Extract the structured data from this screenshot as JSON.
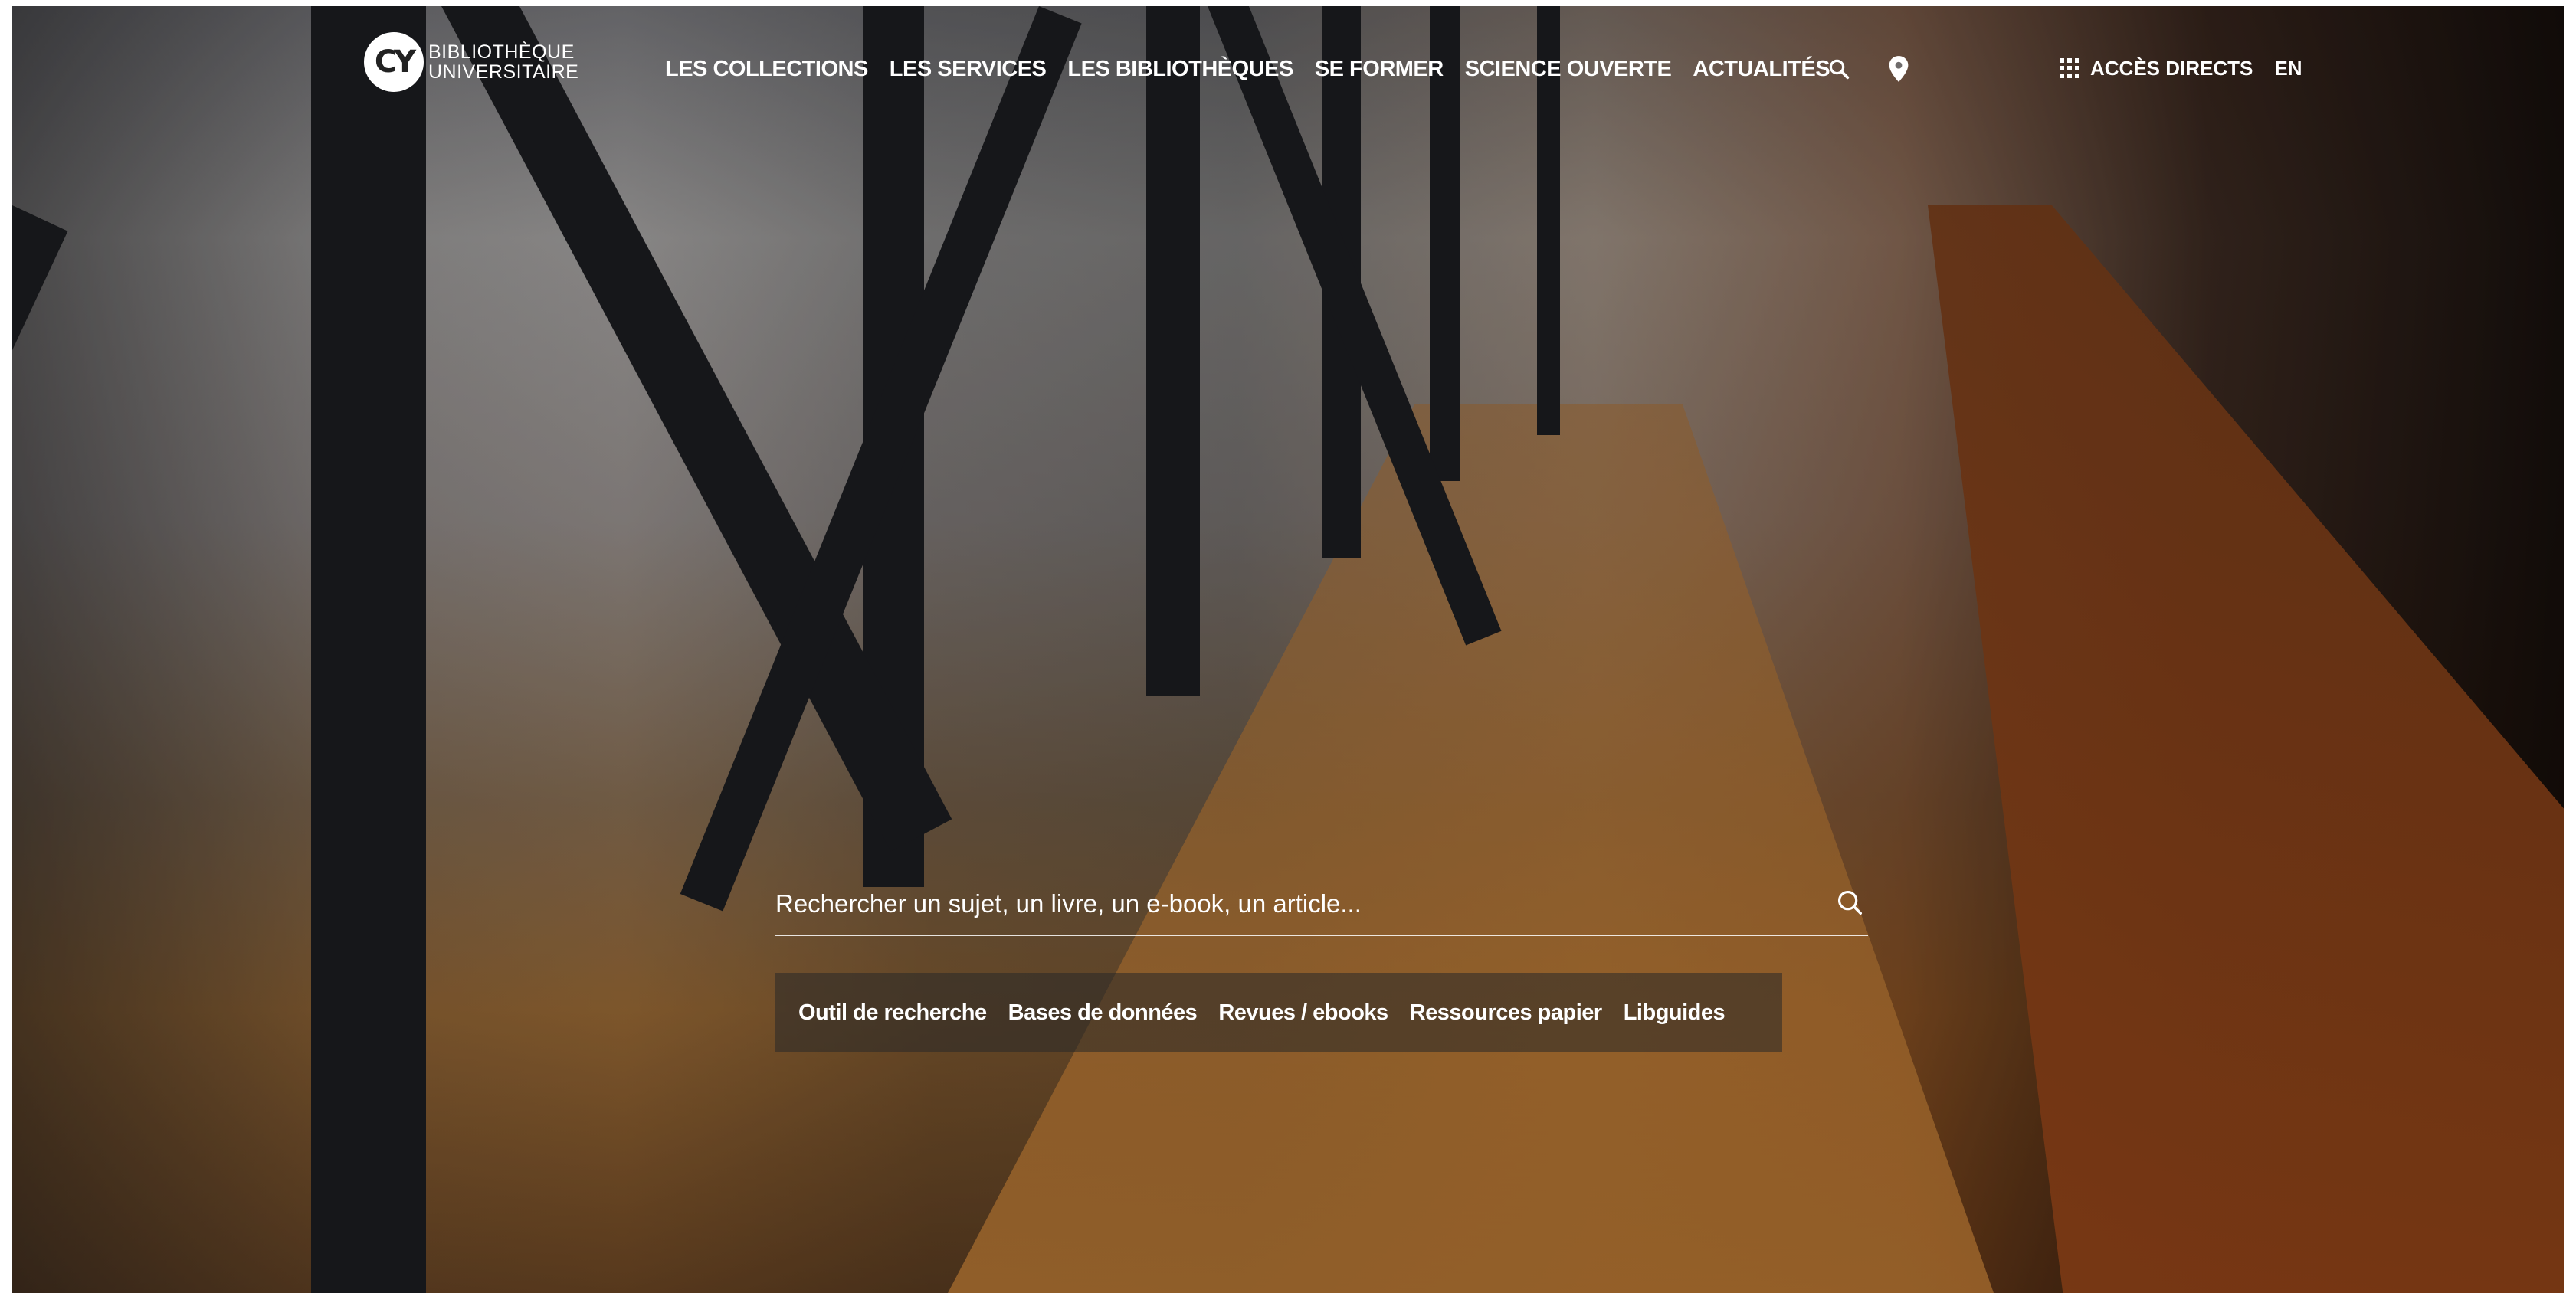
{
  "logo": {
    "mark": "CY",
    "line1": "BIBLIOTHÈQUE",
    "line2": "UNIVERSITAIRE"
  },
  "nav": {
    "items": [
      {
        "label": "LES COLLECTIONS"
      },
      {
        "label": "LES SERVICES"
      },
      {
        "label": "LES BIBLIOTHÈQUES"
      },
      {
        "label": "SE FORMER"
      },
      {
        "label": "SCIENCE OUVERTE"
      },
      {
        "label": "ACTUALITÉS"
      }
    ],
    "icons": [
      "search-icon",
      "location-pin-icon"
    ]
  },
  "right_nav": {
    "direct_access_label": "ACCÈS DIRECTS",
    "language_label": "EN"
  },
  "search": {
    "placeholder": "Rechercher un sujet, un livre, un e-book, un article...",
    "links": [
      {
        "label": "Outil de recherche"
      },
      {
        "label": "Bases de données"
      },
      {
        "label": "Revues / ebooks"
      },
      {
        "label": "Ressources papier"
      },
      {
        "label": "Libguides"
      }
    ]
  },
  "colors": {
    "text": "#ffffff",
    "quick_links_bg": "#282828"
  }
}
